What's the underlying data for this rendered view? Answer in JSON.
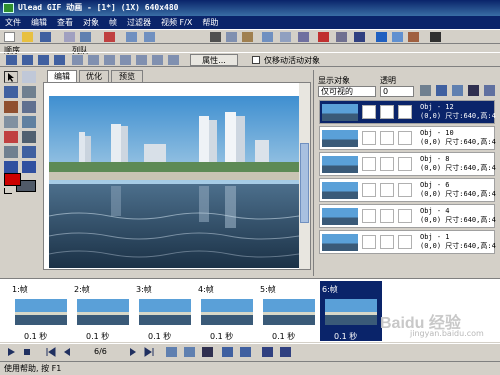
{
  "window": {
    "title": "Ulead GIF 动画 - [1*] (1X) 640x480"
  },
  "menu": [
    "文件",
    "编辑",
    "查看",
    "对象",
    "帧",
    "过滤器",
    "视频 F/X",
    "帮助"
  ],
  "toolbar2": {
    "order_label": "顺序",
    "arrange_label": "列队",
    "properties_button": "属性...",
    "only_move_active_label": "仅移动活动对象"
  },
  "tabs": [
    "编辑",
    "优化",
    "预览"
  ],
  "objects_panel": {
    "display_label": "显示对象",
    "opacity_label": "透明",
    "display_select": "仅可视的",
    "opacity_value": "0",
    "layers": [
      {
        "name": "Obj - 12",
        "line2": "(0,0) 尺寸:640,高:4",
        "selected": true
      },
      {
        "name": "Obj - 10",
        "line2": "(0,0) 尺寸:640,高:4",
        "selected": false
      },
      {
        "name": "Obj - 8",
        "line2": "(0,0) 尺寸:640,高:4",
        "selected": false
      },
      {
        "name": "Obj - 6",
        "line2": "(0,0) 尺寸:640,高:4",
        "selected": false
      },
      {
        "name": "Obj - 4",
        "line2": "(0,0) 尺寸:640,高:4",
        "selected": false
      },
      {
        "name": "Obj - 1",
        "line2": "(0,0) 尺寸:640,高:4",
        "selected": false
      }
    ]
  },
  "frames": [
    {
      "label": "1:帧",
      "delay": "0.1 秒",
      "selected": false
    },
    {
      "label": "2:帧",
      "delay": "0.1 秒",
      "selected": false
    },
    {
      "label": "3:帧",
      "delay": "0.1 秒",
      "selected": false
    },
    {
      "label": "4:帧",
      "delay": "0.1 秒",
      "selected": false
    },
    {
      "label": "5:帧",
      "delay": "0.1 秒",
      "selected": false
    },
    {
      "label": "6:帧",
      "delay": "0.1 秒",
      "selected": true
    }
  ],
  "frame_counter": "6/6",
  "status": "使用帮助, 按 F1",
  "watermark": "Baidu 经验",
  "watermark_sub": "jingyan.baidu.com",
  "colors": {
    "title": "#0a246a",
    "foreground": "#cc0000",
    "background": "#505a68"
  }
}
